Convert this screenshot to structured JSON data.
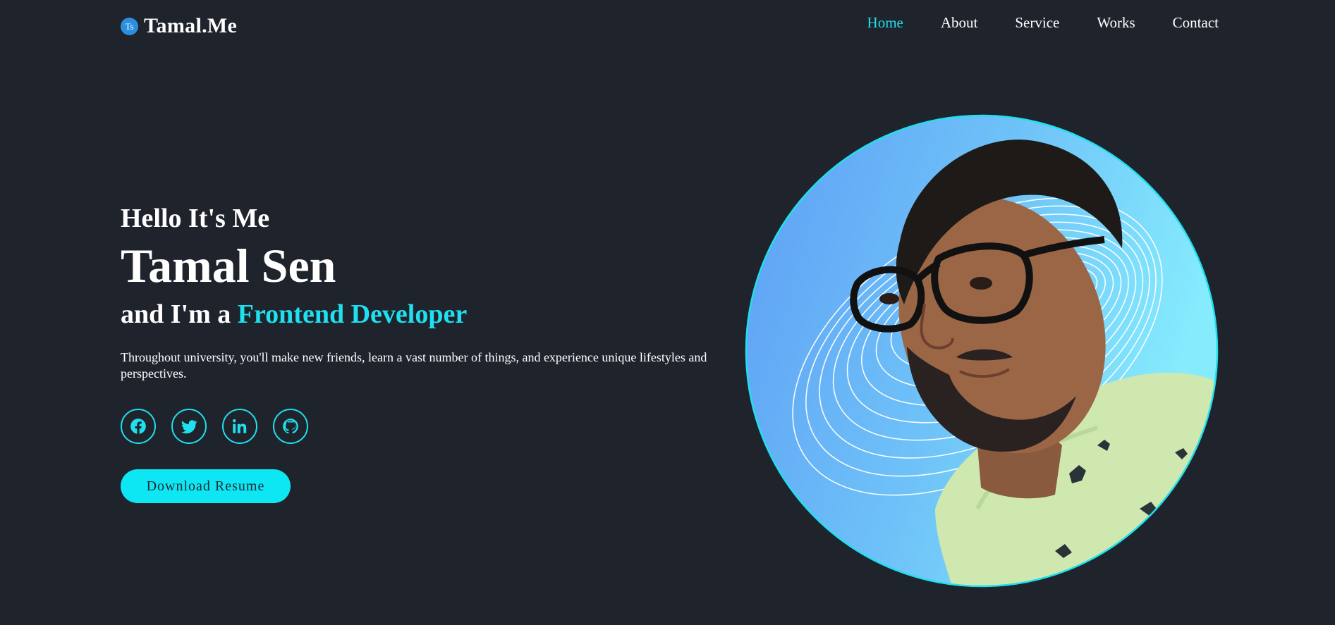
{
  "header": {
    "logo_badge": "Ts",
    "logo_text": "Tamal.Me",
    "nav": [
      {
        "label": "Home",
        "active": true
      },
      {
        "label": "About",
        "active": false
      },
      {
        "label": "Service",
        "active": false
      },
      {
        "label": "Works",
        "active": false
      },
      {
        "label": "Contact",
        "active": false
      }
    ]
  },
  "hero": {
    "greeting": "Hello It's Me",
    "name": "Tamal Sen",
    "role_prefix": "and I'm a",
    "role_highlight": "Frontend Developer",
    "description": "Throughout university, you'll make new friends, learn a vast number of things, and experience unique lifestyles and perspectives.",
    "socials": [
      {
        "icon": "facebook-icon"
      },
      {
        "icon": "twitter-icon"
      },
      {
        "icon": "linkedin-icon"
      },
      {
        "icon": "github-icon"
      }
    ],
    "resume_button": "Download Resume"
  },
  "colors": {
    "background": "#1f232c",
    "accent": "#1fe0ee",
    "button": "#0de7f4",
    "text": "#ffffff"
  }
}
